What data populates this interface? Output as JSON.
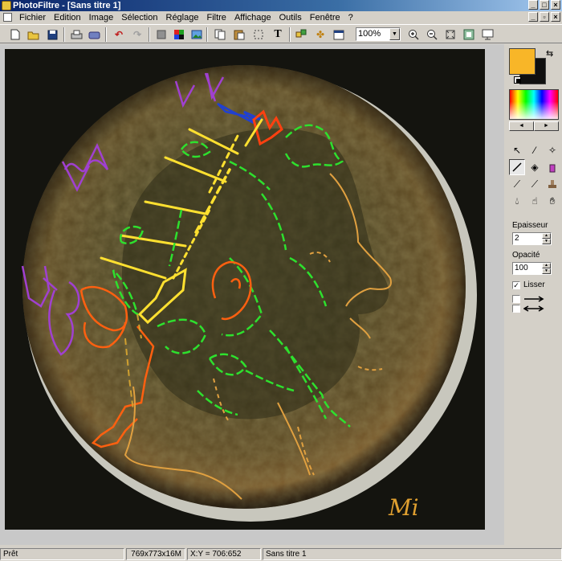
{
  "window": {
    "title": "PhotoFiltre - [Sans titre 1]"
  },
  "menu": [
    "Fichier",
    "Edition",
    "Image",
    "Sélection",
    "Réglage",
    "Filtre",
    "Affichage",
    "Outils",
    "Fenêtre",
    "?"
  ],
  "toolbar": {
    "zoom_value": "100%"
  },
  "colors": {
    "foreground": "#f8b628",
    "background": "#101010"
  },
  "panel": {
    "thickness_label": "Epaisseur",
    "thickness_value": "2",
    "opacity_label": "Opacité",
    "opacity_value": "100",
    "smooth_label": "Lisser"
  },
  "status": {
    "ready": "Prêt",
    "size": "769x773x16M",
    "coords": "X:Y = 706:652",
    "doc": "Sans titre 1"
  },
  "canvas": {
    "signature": "Mi"
  }
}
